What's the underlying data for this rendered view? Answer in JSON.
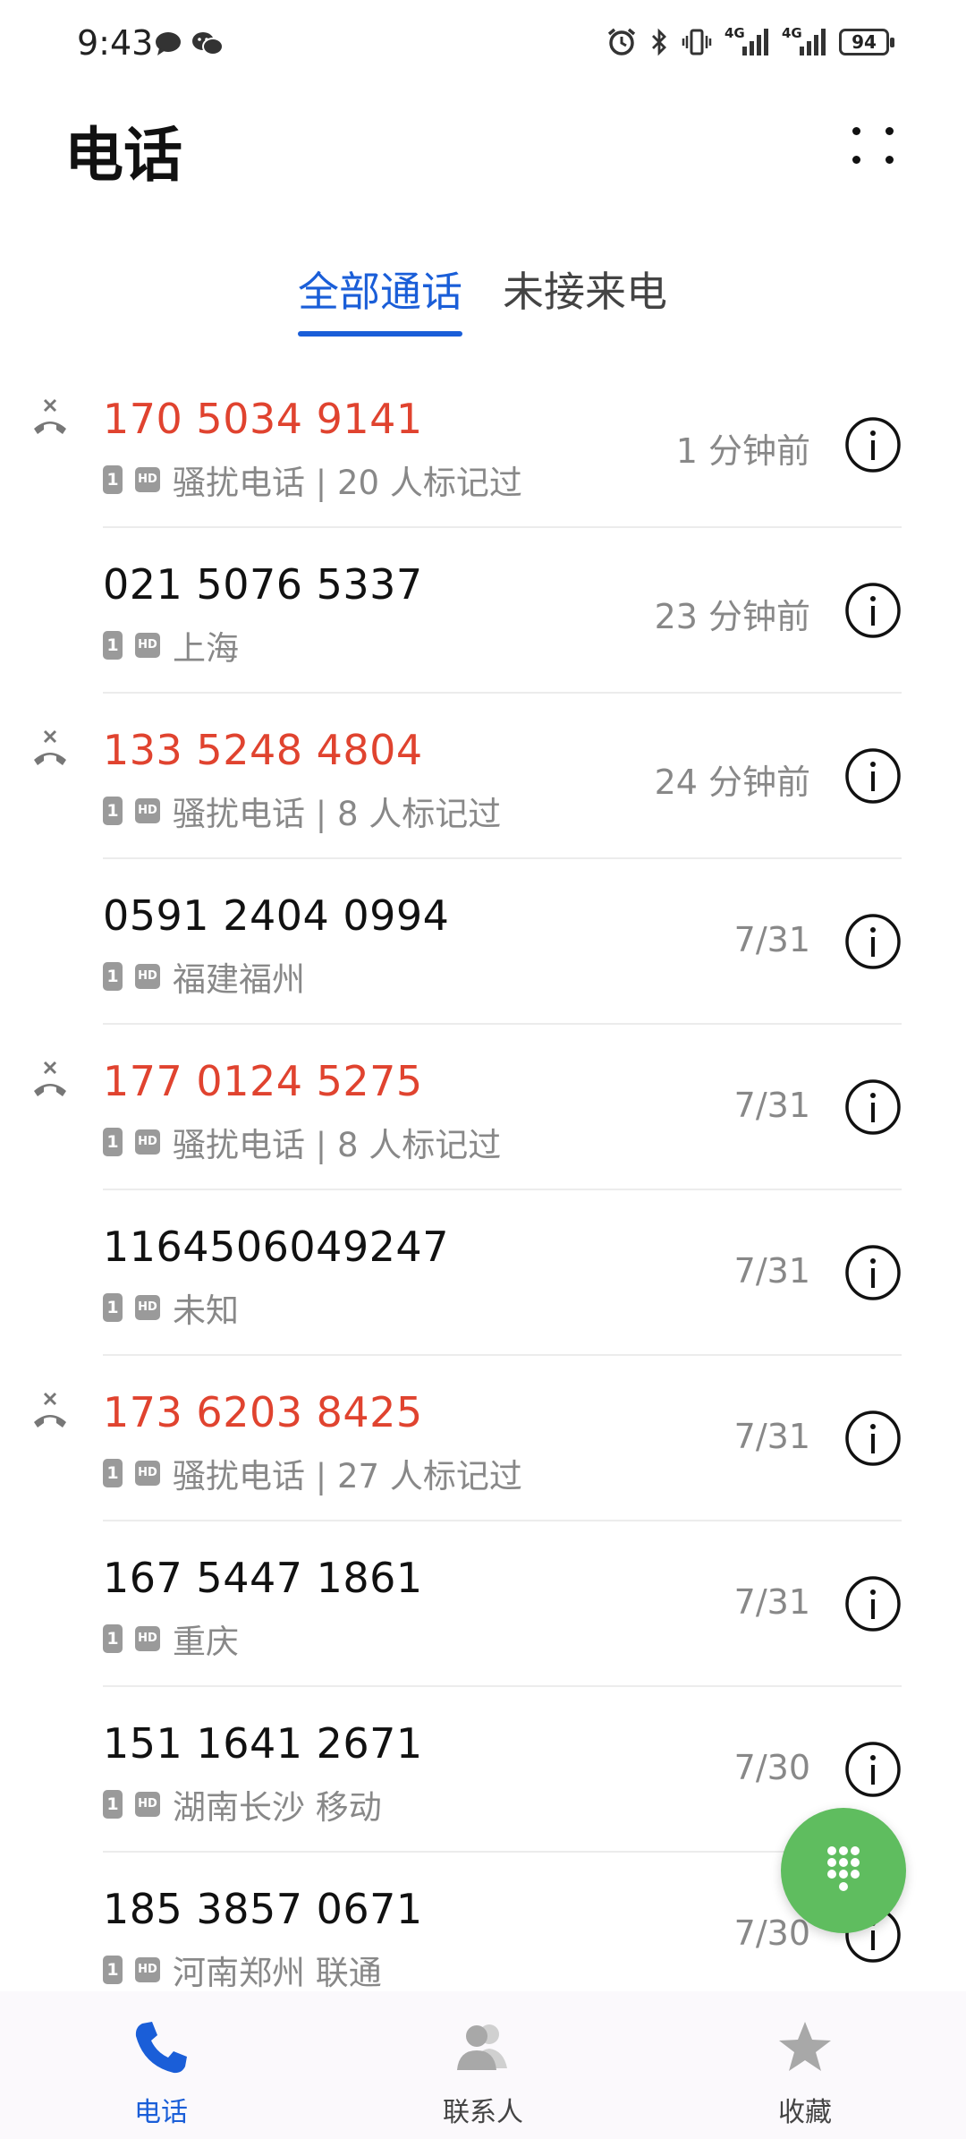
{
  "status_bar": {
    "time": "9:43",
    "net1": "4G",
    "net2": "4G",
    "battery": "94"
  },
  "header": {
    "title": "电话"
  },
  "tabs": [
    {
      "label": "全部通话",
      "selected": true
    },
    {
      "label": "未接来电",
      "selected": false
    }
  ],
  "calls": [
    {
      "number": "170 5034 9141",
      "info": "骚扰电话 | 20 人标记过",
      "time": "1 分钟前",
      "missed": true
    },
    {
      "number": "021 5076 5337",
      "info": "上海",
      "time": "23 分钟前",
      "missed": false
    },
    {
      "number": "133 5248 4804",
      "info": "骚扰电话 | 8 人标记过",
      "time": "24 分钟前",
      "missed": true
    },
    {
      "number": "0591 2404 0994",
      "info": "福建福州",
      "time": "7/31",
      "missed": false
    },
    {
      "number": "177 0124 5275",
      "info": "骚扰电话 | 8 人标记过",
      "time": "7/31",
      "missed": true
    },
    {
      "number": "1164506049247",
      "info": "未知",
      "time": "7/31",
      "missed": false
    },
    {
      "number": "173 6203 8425",
      "info": "骚扰电话 | 27 人标记过",
      "time": "7/31",
      "missed": true
    },
    {
      "number": "167 5447 1861",
      "info": "重庆",
      "time": "7/31",
      "missed": false
    },
    {
      "number": "151 1641 2671",
      "info": "湖南长沙 移动",
      "time": "7/30",
      "missed": false
    },
    {
      "number": "185 3857 0671",
      "info": "河南郑州 联通",
      "time": "7/30",
      "missed": false
    }
  ],
  "badges": {
    "sim": "1",
    "hd": "HD"
  },
  "bottom_nav": [
    {
      "label": "电话",
      "icon": "phone-icon",
      "active": true
    },
    {
      "label": "联系人",
      "icon": "contacts-icon",
      "active": false
    },
    {
      "label": "收藏",
      "icon": "star-icon",
      "active": false
    }
  ],
  "colors": {
    "accent": "#1a5ed8",
    "missed": "#e0432f",
    "fab": "#5fbd5f"
  }
}
